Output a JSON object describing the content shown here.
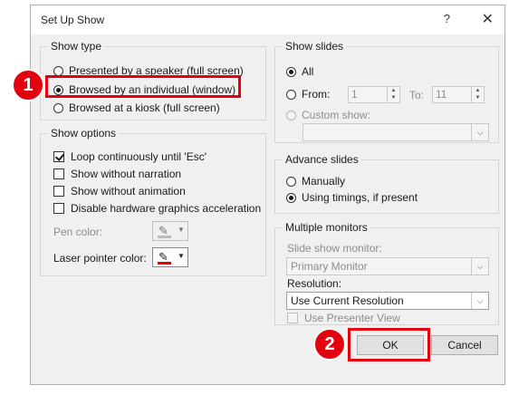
{
  "dialog": {
    "title": "Set Up Show",
    "help": "?",
    "close": "✕"
  },
  "show_type": {
    "legend": "Show type",
    "opt_speaker": "Presented by a speaker (full screen)",
    "opt_individual": "Browsed by an individual (window)",
    "opt_kiosk": "Browsed at a kiosk (full screen)",
    "selected": "opt_individual"
  },
  "show_options": {
    "legend": "Show options",
    "loop": "Loop continuously until 'Esc'",
    "loop_checked": true,
    "no_narration": "Show without narration",
    "no_animation": "Show without animation",
    "disable_hw": "Disable hardware graphics acceleration",
    "pen_color": "Pen color:",
    "laser_color": "Laser pointer color:"
  },
  "show_slides": {
    "legend": "Show slides",
    "all": "All",
    "from": "From:",
    "from_value": "1",
    "to": "To:",
    "to_value": "11",
    "custom": "Custom show:"
  },
  "advance_slides": {
    "legend": "Advance slides",
    "manually": "Manually",
    "timings": "Using timings, if present",
    "selected": "timings"
  },
  "monitors": {
    "legend": "Multiple monitors",
    "slide_monitor_label": "Slide show monitor:",
    "slide_monitor_value": "Primary Monitor",
    "resolution_label": "Resolution:",
    "resolution_value": "Use Current Resolution",
    "presenter_view": "Use Presenter View"
  },
  "buttons": {
    "ok": "OK",
    "cancel": "Cancel"
  },
  "callouts": {
    "one": "1",
    "two": "2"
  },
  "colors": {
    "callout": "#e3000f",
    "laser": "#e60000"
  }
}
